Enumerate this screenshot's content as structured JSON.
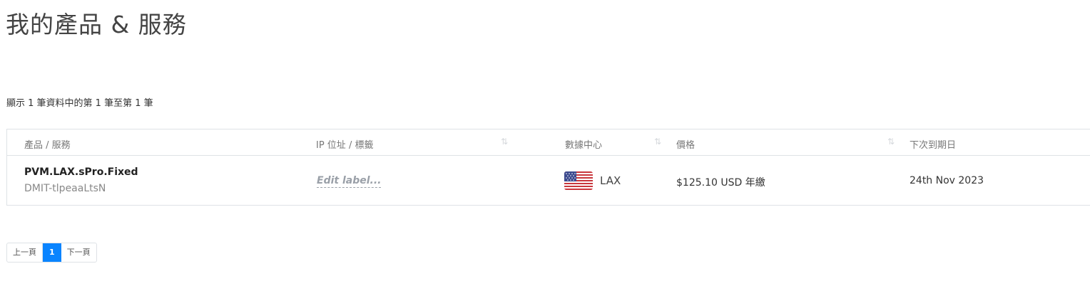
{
  "header": {
    "title": "我的產品 & 服務"
  },
  "table_info": "顯示 1 筆資料中的第 1 筆至第 1 筆",
  "table": {
    "columns": [
      "產品 / 服務",
      "IP 位址 / 標籤",
      "數據中心",
      "價格",
      "下次到期日"
    ],
    "rows": [
      {
        "product": "PVM.LAX.sPro.Fixed",
        "service_id": "DMIT-tlpeaaLtsN",
        "label_placeholder": "Edit label...",
        "datacenter": "LAX",
        "price": "$125.10 USD 年繳",
        "due_date": "24th Nov 2023"
      }
    ]
  },
  "pagination": {
    "prev": "上一頁",
    "current": "1",
    "next": "下一頁"
  },
  "colors": {
    "accent": "#0a84ff",
    "border": "#dee2e6"
  }
}
